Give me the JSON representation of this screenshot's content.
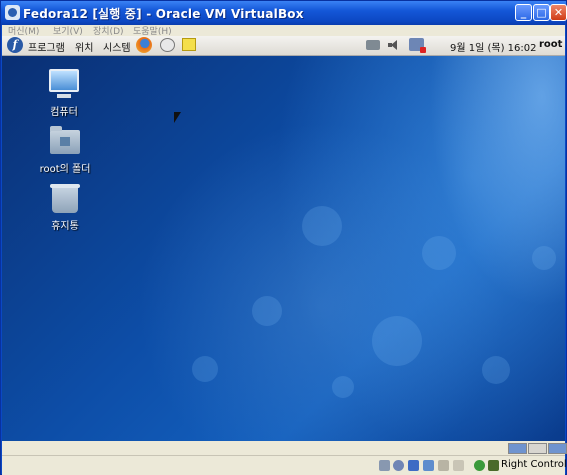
{
  "window": {
    "title": "Fedora12 [실행 중] - Oracle VM VirtualBox",
    "minimize_glyph": "_",
    "maximize_glyph": "□",
    "close_glyph": "✕"
  },
  "menubar": {
    "items": [
      "머신(M)",
      "보기(V)",
      "장치(D)",
      "도움말(H)"
    ]
  },
  "guest_panel": {
    "menus": [
      "프로그램",
      "위치",
      "시스템"
    ],
    "launchers": [
      "firefox-icon",
      "mail-icon",
      "note-icon"
    ],
    "tray_icons": [
      "network-icon",
      "volume-icon",
      "update-icon"
    ],
    "clock": "9월  1일 (목) 16:02",
    "user": "root"
  },
  "desktop": {
    "icons": [
      {
        "label": "컴퓨터",
        "icon": "computer-icon"
      },
      {
        "label": "root의 폴더",
        "icon": "home-folder-icon"
      },
      {
        "label": "휴지통",
        "icon": "trash-icon"
      }
    ]
  },
  "statusbar": {
    "host_key_label": "Right Control"
  },
  "colors": {
    "titlebar": "#0c47c2",
    "desktop": "#0d4ea8",
    "chrome": "#ece9d8"
  }
}
